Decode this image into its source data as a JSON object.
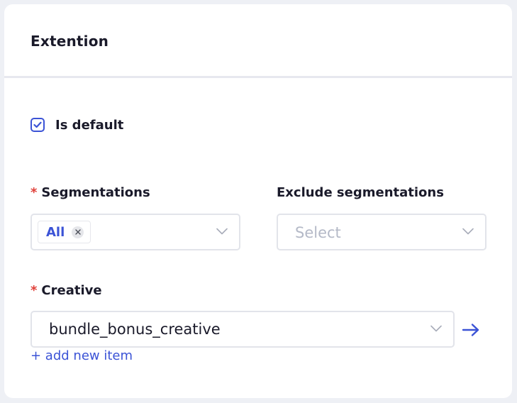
{
  "card": {
    "title": "Extention"
  },
  "is_default": {
    "label": "Is default",
    "checked": true
  },
  "segmentations": {
    "label": "Segmentations",
    "required_marker": "*",
    "selected_tags": [
      "All"
    ]
  },
  "exclude_segmentations": {
    "label": "Exclude segmentations",
    "placeholder": "Select"
  },
  "creative": {
    "label": "Creative",
    "required_marker": "*",
    "value": "bundle_bonus_creative",
    "add_new_label": "+ add new item"
  },
  "colors": {
    "accent": "#3b53d6",
    "required": "#e0403a",
    "border": "#e2e4ea",
    "background": "#eef0f5"
  },
  "icons": {
    "checkbox": "check-icon",
    "tag_close": "close-icon",
    "dropdown": "chevron-down-icon",
    "navigate": "arrow-right-icon"
  }
}
